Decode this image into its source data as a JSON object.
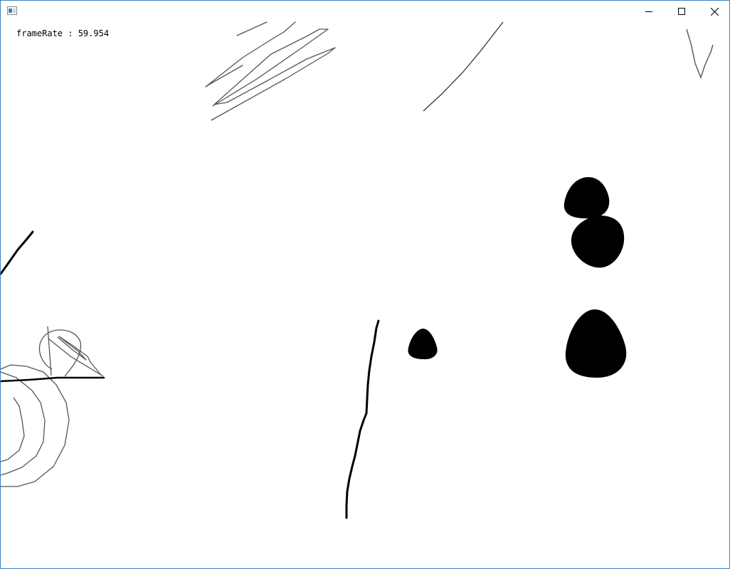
{
  "window": {
    "controls": {
      "minimize": "minimize",
      "maximize": "maximize",
      "close": "close"
    },
    "border_color": "#3c7fc1"
  },
  "overlay": {
    "framerate_text": "frameRate : 59.954"
  },
  "icons": {
    "app": "app-window-icon",
    "minimize": "minimize-icon",
    "maximize": "maximize-icon",
    "close": "close-icon"
  },
  "colors": {
    "canvas_bg": "#ffffff",
    "thin_stroke": "#555555",
    "ink": "#000000"
  }
}
